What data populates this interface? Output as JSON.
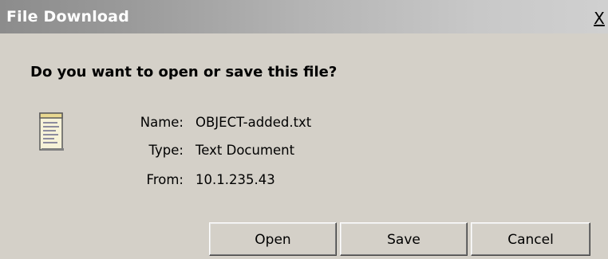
{
  "window": {
    "title": "File Download",
    "close_label": "X"
  },
  "dialog": {
    "question": "Do you want to open or save this file?",
    "file_icon": "text-document-icon",
    "name_label": "Name:",
    "name_value": "OBJECT-added.txt",
    "type_label": "Type:",
    "type_value": "Text Document",
    "from_label": "From:",
    "from_value": "10.1.235.43"
  },
  "buttons": {
    "open_label": "Open",
    "save_label": "Save",
    "cancel_label": "Cancel"
  }
}
